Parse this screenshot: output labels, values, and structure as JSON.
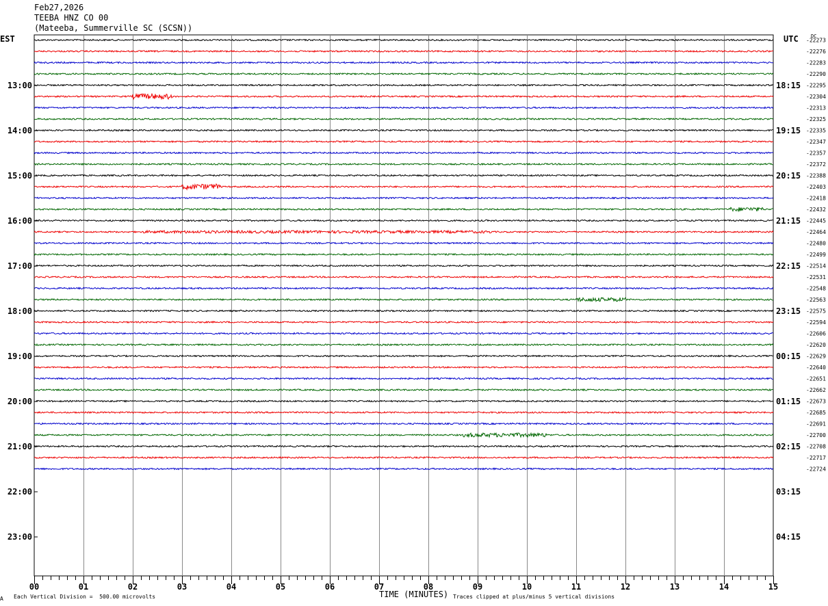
{
  "header": {
    "date": "Feb27,2026",
    "station": "TEEBA HNZ CO 00",
    "location": "(Mateeba, Summerville SC (SCSN))"
  },
  "left_tz": "EST",
  "right_tz": "UTC",
  "dc_label": "DC",
  "footer": {
    "scale_note": "Each Vertical Division =  500.00 microvolts",
    "x_title": "TIME (MINUTES)",
    "clip_note": "Traces clipped at plus/minus 5 vertical divisions",
    "corner_mark": "A"
  },
  "chart_data": {
    "type": "line",
    "title": "TEEBA HNZ CO 00",
    "xlabel": "TIME (MINUTES)",
    "xlim": [
      0,
      15
    ],
    "x_ticks": [
      "00",
      "01",
      "02",
      "03",
      "04",
      "05",
      "06",
      "07",
      "08",
      "09",
      "10",
      "11",
      "12",
      "13",
      "14",
      "15"
    ],
    "hours_left": [
      "13:00",
      "14:00",
      "15:00",
      "16:00",
      "17:00",
      "18:00",
      "19:00",
      "20:00",
      "21:00",
      "22:00",
      "23:00"
    ],
    "hours_right": [
      "18:15",
      "19:15",
      "20:15",
      "21:15",
      "22:15",
      "23:15",
      "00:15",
      "01:15",
      "02:15",
      "03:15",
      "04:15"
    ],
    "trace_colors": [
      "#000000",
      "#ee0000",
      "#0000cc",
      "#006600"
    ],
    "dc_offsets": [
      "-22273",
      "-22276",
      "-22283",
      "-22290",
      "-22295",
      "-22304",
      "-22313",
      "-22325",
      "-22335",
      "-22347",
      "-22357",
      "-22372",
      "-22388",
      "-22403",
      "-22418",
      "-22432",
      "-22445",
      "-22464",
      "-22480",
      "-22499",
      "-22514",
      "-22531",
      "-22548",
      "-22563",
      "-22575",
      "-22594",
      "-22606",
      "-22620",
      "-22629",
      "-22640",
      "-22651",
      "-22662",
      "-22673",
      "-22685",
      "-22691",
      "-22700",
      "-22708",
      "-22717",
      "-22724"
    ],
    "events": [
      {
        "trace": 5,
        "x_start": 2.0,
        "x_end": 2.8,
        "amp": 4
      },
      {
        "trace": 13,
        "x_start": 3.0,
        "x_end": 3.8,
        "amp": 4
      },
      {
        "trace": 15,
        "x_start": 14.1,
        "x_end": 14.8,
        "amp": 3
      },
      {
        "trace": 17,
        "x_start": 2.2,
        "x_end": 9.3,
        "amp": 2
      },
      {
        "trace": 23,
        "x_start": 11.0,
        "x_end": 12.0,
        "amp": 3
      },
      {
        "trace": 35,
        "x_start": 8.7,
        "x_end": 10.4,
        "amp": 3
      }
    ],
    "grid": true
  }
}
